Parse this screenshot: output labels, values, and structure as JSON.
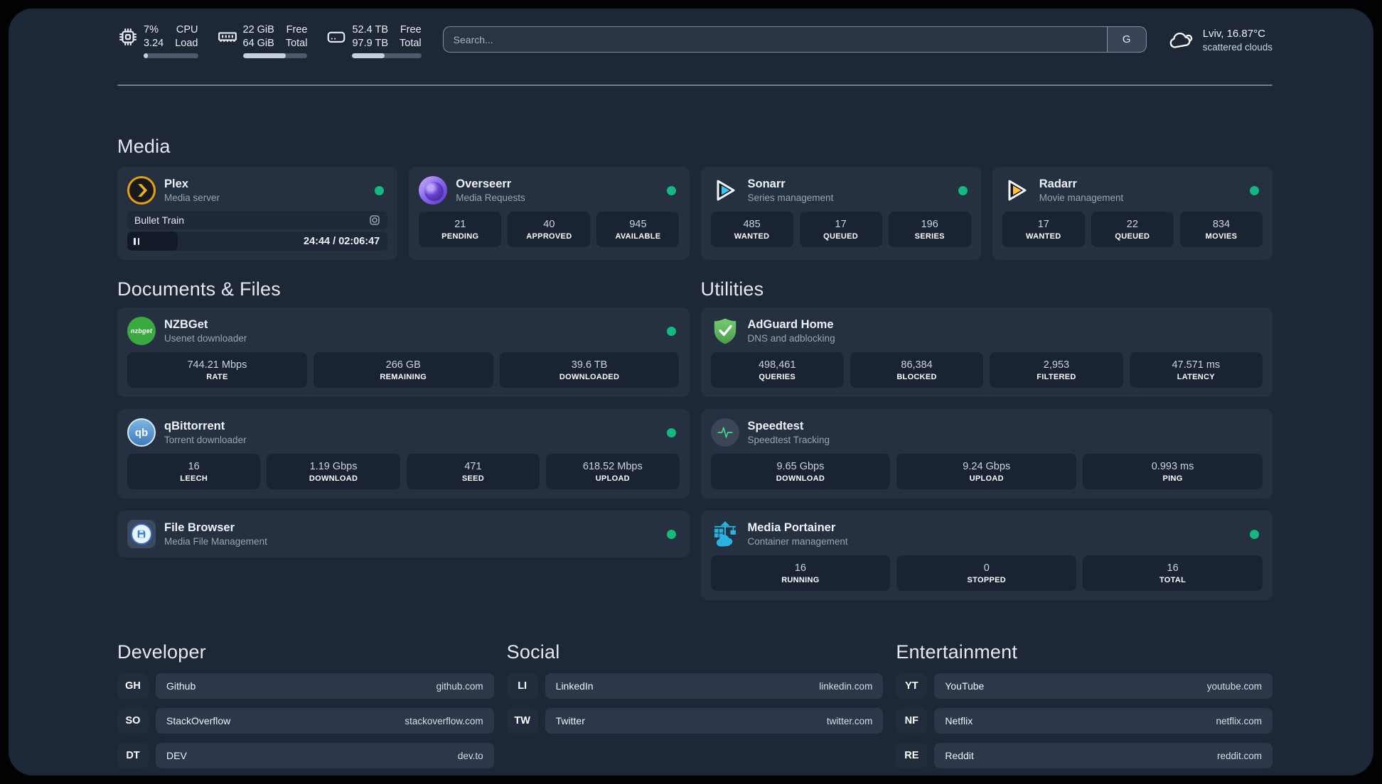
{
  "colors": {
    "status_online": "#15b97f",
    "panel_bg": "#1d2736",
    "card_bg": "#253040",
    "accent_portainer": "#29b2e4",
    "accent_sonarr": "#35c5f4",
    "accent_radarr": "#ffc230",
    "accent_plex": "#e5a00d"
  },
  "topbar": {
    "resources": [
      {
        "icon": "cpu-icon",
        "rows": [
          {
            "value": "7%",
            "label": "CPU"
          },
          {
            "value": "3.24",
            "label": "Load"
          }
        ],
        "progress_percent": 8
      },
      {
        "icon": "memory-icon",
        "rows": [
          {
            "value": "22 GiB",
            "label": "Free"
          },
          {
            "value": "64 GiB",
            "label": "Total"
          }
        ],
        "progress_percent": 66
      },
      {
        "icon": "disk-icon",
        "rows": [
          {
            "value": "52.4 TB",
            "label": "Free"
          },
          {
            "value": "97.9 TB",
            "label": "Total"
          }
        ],
        "progress_percent": 47
      }
    ],
    "search": {
      "placeholder": "Search...",
      "provider_button": "G"
    },
    "weather": {
      "icon": "cloud-icon",
      "location": "Lviv, 16.87°C",
      "condition": "scattered clouds"
    }
  },
  "media": {
    "heading": "Media",
    "plex": {
      "icon": "plex-icon",
      "title": "Plex",
      "subtitle": "Media server",
      "online": true,
      "now_playing": {
        "title": "Bullet Train",
        "time": "24:44 / 02:06:47",
        "progress_percent": 19.5,
        "state": "paused"
      }
    },
    "overseerr": {
      "icon": "overseerr-icon",
      "title": "Overseerr",
      "subtitle": "Media Requests",
      "online": true,
      "stats": [
        {
          "value": "21",
          "label": "PENDING"
        },
        {
          "value": "40",
          "label": "APPROVED"
        },
        {
          "value": "945",
          "label": "AVAILABLE"
        }
      ]
    },
    "sonarr": {
      "icon": "sonarr-icon",
      "title": "Sonarr",
      "subtitle": "Series management",
      "online": true,
      "stats": [
        {
          "value": "485",
          "label": "WANTED"
        },
        {
          "value": "17",
          "label": "QUEUED"
        },
        {
          "value": "196",
          "label": "SERIES"
        }
      ]
    },
    "radarr": {
      "icon": "radarr-icon",
      "title": "Radarr",
      "subtitle": "Movie management",
      "online": true,
      "stats": [
        {
          "value": "17",
          "label": "WANTED"
        },
        {
          "value": "22",
          "label": "QUEUED"
        },
        {
          "value": "834",
          "label": "MOVIES"
        }
      ]
    }
  },
  "documents": {
    "heading": "Documents & Files",
    "nzbget": {
      "icon": "nzbget-icon",
      "icon_text": "nzbget",
      "title": "NZBGet",
      "subtitle": "Usenet downloader",
      "online": true,
      "stats": [
        {
          "value": "744.21 Mbps",
          "label": "RATE"
        },
        {
          "value": "266 GB",
          "label": "REMAINING"
        },
        {
          "value": "39.6 TB",
          "label": "DOWNLOADED"
        }
      ]
    },
    "qbittorrent": {
      "icon": "qbittorrent-icon",
      "icon_text": "qb",
      "title": "qBittorrent",
      "subtitle": "Torrent downloader",
      "online": true,
      "stats": [
        {
          "value": "16",
          "label": "LEECH"
        },
        {
          "value": "1.19 Gbps",
          "label": "DOWNLOAD"
        },
        {
          "value": "471",
          "label": "SEED"
        },
        {
          "value": "618.52 Mbps",
          "label": "UPLOAD"
        }
      ]
    },
    "filebrowser": {
      "icon": "filebrowser-icon",
      "title": "File Browser",
      "subtitle": "Media File Management",
      "online": true
    }
  },
  "utilities": {
    "heading": "Utilities",
    "adguard": {
      "icon": "adguard-icon",
      "title": "AdGuard Home",
      "subtitle": "DNS and adblocking",
      "online": false,
      "stats": [
        {
          "value": "498,461",
          "label": "QUERIES"
        },
        {
          "value": "86,384",
          "label": "BLOCKED"
        },
        {
          "value": "2,953",
          "label": "FILTERED"
        },
        {
          "value": "47.571 ms",
          "label": "LATENCY"
        }
      ]
    },
    "speedtest": {
      "icon": "speedtest-icon",
      "title": "Speedtest",
      "subtitle": "Speedtest Tracking",
      "online": false,
      "stats": [
        {
          "value": "9.65 Gbps",
          "label": "DOWNLOAD"
        },
        {
          "value": "9.24 Gbps",
          "label": "UPLOAD"
        },
        {
          "value": "0.993 ms",
          "label": "PING"
        }
      ]
    },
    "portainer": {
      "icon": "portainer-icon",
      "title": "Media Portainer",
      "subtitle": "Container management",
      "online": true,
      "stats": [
        {
          "value": "16",
          "label": "RUNNING"
        },
        {
          "value": "0",
          "label": "STOPPED"
        },
        {
          "value": "16",
          "label": "TOTAL"
        }
      ]
    }
  },
  "bookmarks": [
    {
      "heading": "Developer",
      "links": [
        {
          "abbr": "GH",
          "name": "Github",
          "url": "github.com"
        },
        {
          "abbr": "SO",
          "name": "StackOverflow",
          "url": "stackoverflow.com"
        },
        {
          "abbr": "DT",
          "name": "DEV",
          "url": "dev.to"
        }
      ]
    },
    {
      "heading": "Social",
      "links": [
        {
          "abbr": "LI",
          "name": "LinkedIn",
          "url": "linkedin.com"
        },
        {
          "abbr": "TW",
          "name": "Twitter",
          "url": "twitter.com"
        }
      ]
    },
    {
      "heading": "Entertainment",
      "links": [
        {
          "abbr": "YT",
          "name": "YouTube",
          "url": "youtube.com"
        },
        {
          "abbr": "NF",
          "name": "Netflix",
          "url": "netflix.com"
        },
        {
          "abbr": "RE",
          "name": "Reddit",
          "url": "reddit.com"
        }
      ]
    }
  ]
}
